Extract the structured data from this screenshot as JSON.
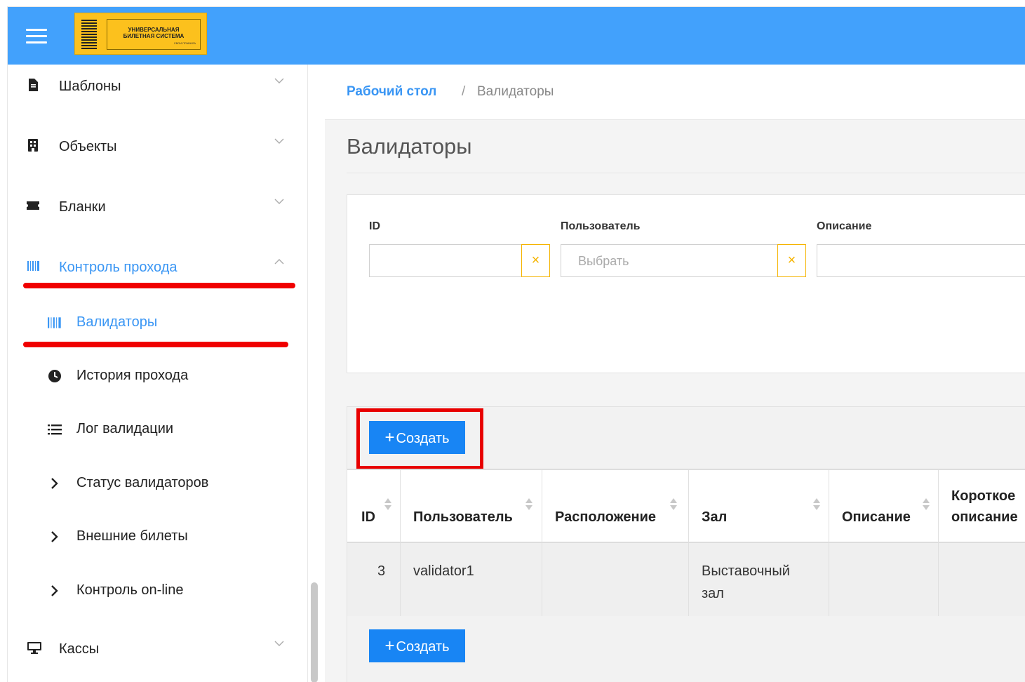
{
  "header": {
    "logo_line1": "УНИВЕРСАЛЬНАЯ",
    "logo_line2": "БИЛЕТНАЯ СИСТЕМА",
    "logo_line3": "СВОИ ПРАВИЛА",
    "bg_color": "#42a1fc",
    "logo_color": "#fcc11d"
  },
  "sidebar": {
    "items": [
      {
        "label": "Шаблоны",
        "icon": "document-icon"
      },
      {
        "label": "Объекты",
        "icon": "building-icon"
      },
      {
        "label": "Бланки",
        "icon": "ticket-icon"
      },
      {
        "label": "Контроль прохода",
        "icon": "barcode-icon"
      },
      {
        "label": "Кассы",
        "icon": "monitor-icon"
      }
    ],
    "subitems": [
      {
        "label": "Валидаторы",
        "icon": "barcode-icon"
      },
      {
        "label": "История прохода",
        "icon": "clock-icon"
      },
      {
        "label": "Лог валидации",
        "icon": "list-icon"
      },
      {
        "label": "Статус валидаторов",
        "icon": "chevron-right-icon"
      },
      {
        "label": "Внешние билеты",
        "icon": "chevron-right-icon"
      },
      {
        "label": "Контроль on-line",
        "icon": "chevron-right-icon"
      }
    ],
    "active_color": "#3a96f4"
  },
  "breadcrumb": {
    "home": "Рабочий стол",
    "separator": "/",
    "current": "Валидаторы"
  },
  "page_title": "Валидаторы",
  "filters": {
    "id_label": "ID",
    "id_value": "",
    "user_label": "Пользователь",
    "user_placeholder": "Выбрать",
    "description_label": "Описание",
    "description_value": "",
    "clear_symbol": "×"
  },
  "actions": {
    "create_plus": "+",
    "create_label": "Создать"
  },
  "table": {
    "columns": [
      "ID",
      "Пользователь",
      "Расположение",
      "Зал",
      "Описание",
      "Короткое описание"
    ],
    "column_short_line1": "Короткое",
    "column_short_line2": "описание",
    "rows": [
      {
        "id": "3",
        "user": "validator1",
        "location": "",
        "hall_line1": "Выставочный",
        "hall_line2": "зал",
        "description": "",
        "short_description": ""
      }
    ]
  },
  "colors": {
    "primary_button": "#1885f4",
    "clear_button": "#f5b400",
    "highlight": "#e80000"
  }
}
